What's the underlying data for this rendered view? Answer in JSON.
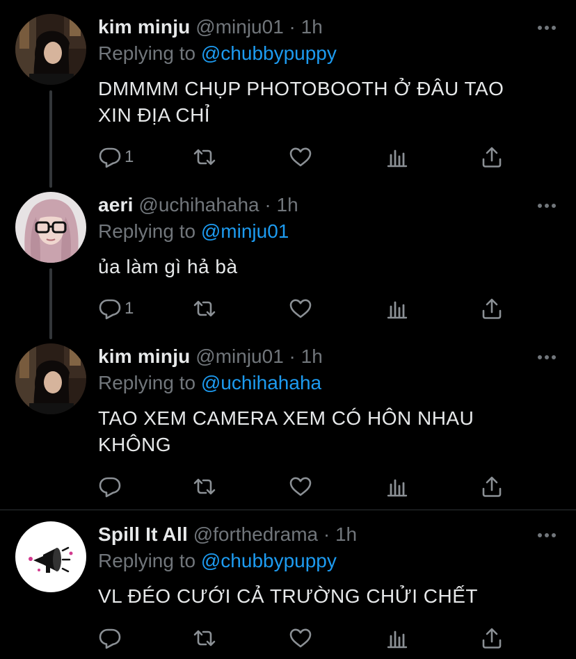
{
  "tweets": [
    {
      "name": "kim minju",
      "handle": "@minju01",
      "sep": "·",
      "time": "1h",
      "replying_prefix": "Replying to ",
      "replying_to": "@chubbypuppy",
      "lines": [
        "DMMMM CHỤP PHOTOBOOTH Ở ĐÂU TAO",
        "XIN ĐỊA CHỈ"
      ],
      "reply_count": "1",
      "avatar": "photo-girl-dark-hair"
    },
    {
      "name": "aeri",
      "handle": "@uchihahaha",
      "sep": "·",
      "time": "1h",
      "replying_prefix": "Replying to ",
      "replying_to": "@minju01",
      "lines": [
        "ủa làm gì hả bà"
      ],
      "reply_count": "1",
      "avatar": "photo-girl-pink-hair-glasses"
    },
    {
      "name": "kim minju",
      "handle": "@minju01",
      "sep": "·",
      "time": "1h",
      "replying_prefix": "Replying to ",
      "replying_to": "@uchihahaha",
      "lines": [
        "TAO XEM CAMERA XEM CÓ HÔN NHAU",
        "KHÔNG"
      ],
      "reply_count": "",
      "avatar": "photo-girl-dark-hair"
    },
    {
      "name": "Spill It All",
      "handle": "@forthedrama",
      "sep": "·",
      "time": "1h",
      "replying_prefix": "Replying to ",
      "replying_to": "@chubbypuppy",
      "lines": [
        "VL ĐÉO CƯỚI CẢ TRƯỜNG CHỬI CHẾT"
      ],
      "reply_count": "",
      "avatar": "megaphone-logo"
    }
  ],
  "icons": {
    "reply": "reply-icon",
    "retweet": "retweet-icon",
    "like": "heart-icon",
    "analytics": "analytics-icon",
    "share": "share-icon",
    "more": "more-icon"
  },
  "colors": {
    "background": "#000000",
    "text": "#e7e9ea",
    "secondary": "#71767b",
    "accent": "#1d9bf0",
    "thread_line": "#333639"
  }
}
